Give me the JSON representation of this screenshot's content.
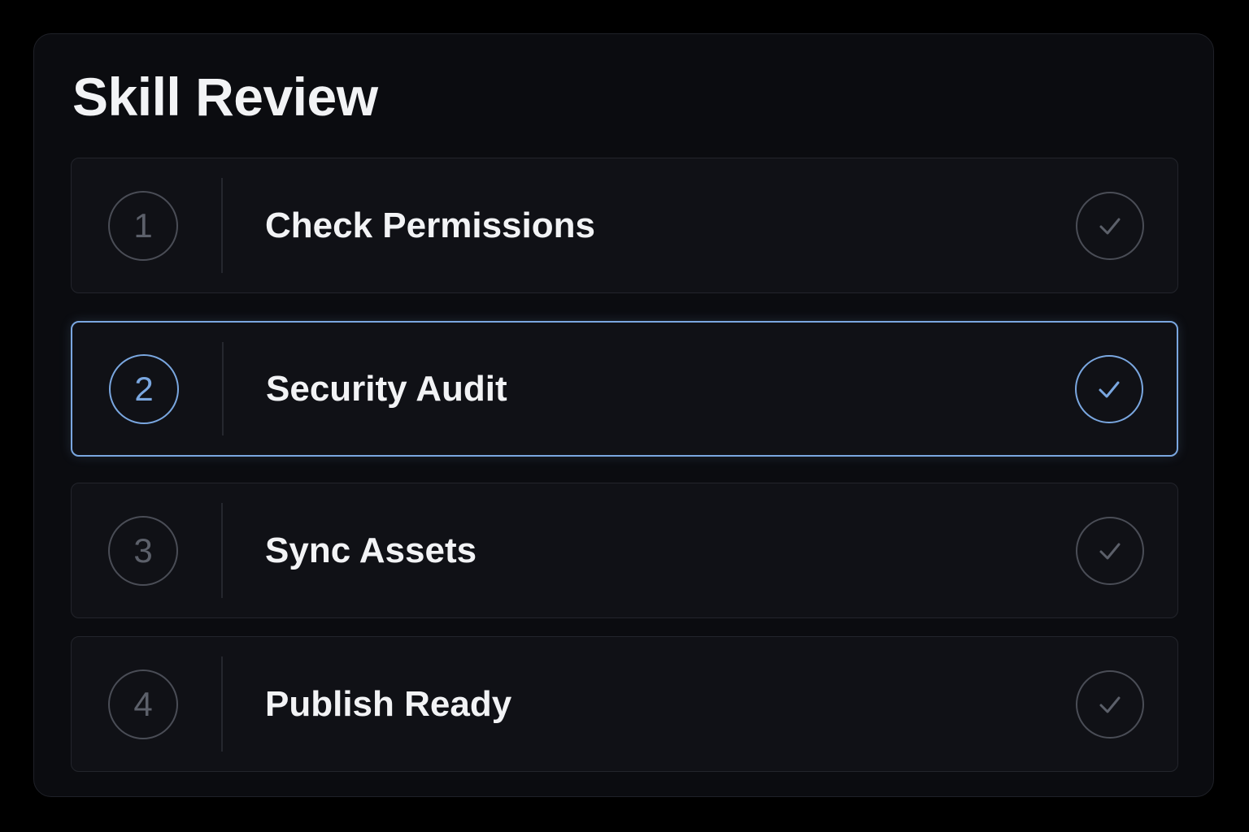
{
  "title": "Skill Review",
  "accent_color": "#7aa7e0",
  "steps": [
    {
      "number": "1",
      "label": "Check Permissions",
      "icon": "check-icon",
      "active": false
    },
    {
      "number": "2",
      "label": "Security Audit",
      "icon": "check-icon",
      "active": true
    },
    {
      "number": "3",
      "label": "Sync Assets",
      "icon": "check-icon",
      "active": false
    },
    {
      "number": "4",
      "label": "Publish Ready",
      "icon": "check-icon",
      "active": false
    }
  ]
}
